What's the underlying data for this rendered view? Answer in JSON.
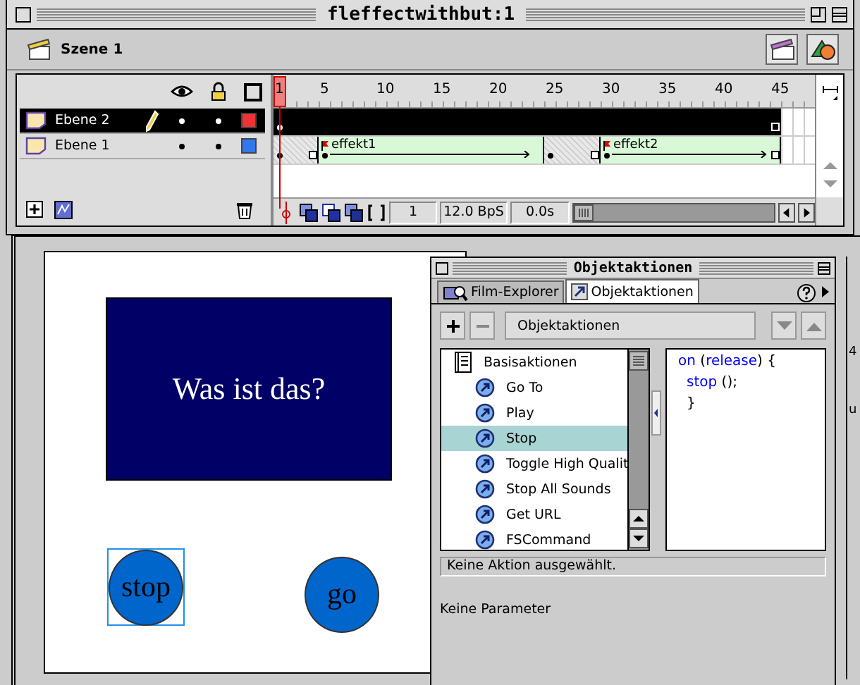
{
  "window": {
    "title": "fleffectwithbut:1"
  },
  "scene": {
    "label": "Szene 1"
  },
  "timeline": {
    "ruler": [
      "1",
      "5",
      "10",
      "15",
      "20",
      "25",
      "30",
      "35",
      "40",
      "45"
    ],
    "layers": [
      {
        "name": "Ebene 2",
        "selected": true,
        "color": "#ee3333",
        "spans": [
          {
            "kind": "static",
            "frames": [
              {
                "kind": "key"
              },
              {
                "kind": "held"
              },
              {
                "kind": "held"
              },
              {
                "kind": "held"
              },
              {
                "kind": "held"
              },
              {
                "kind": "held"
              },
              {
                "kind": "held"
              },
              {
                "kind": "held"
              },
              {
                "kind": "held"
              },
              {
                "kind": "held"
              },
              {
                "kind": "held"
              },
              {
                "kind": "held"
              },
              {
                "kind": "held"
              },
              {
                "kind": "held"
              },
              {
                "kind": "held"
              },
              {
                "kind": "held"
              },
              {
                "kind": "held"
              },
              {
                "kind": "held"
              },
              {
                "kind": "held"
              },
              {
                "kind": "held"
              },
              {
                "kind": "held"
              },
              {
                "kind": "held"
              },
              {
                "kind": "held"
              },
              {
                "kind": "held"
              },
              {
                "kind": "held"
              },
              {
                "kind": "held"
              },
              {
                "kind": "held"
              },
              {
                "kind": "held"
              },
              {
                "kind": "held"
              },
              {
                "kind": "held"
              },
              {
                "kind": "held"
              },
              {
                "kind": "held"
              },
              {
                "kind": "held"
              },
              {
                "kind": "held"
              },
              {
                "kind": "held"
              },
              {
                "kind": "held"
              },
              {
                "kind": "held"
              },
              {
                "kind": "held"
              },
              {
                "kind": "held"
              },
              {
                "kind": "held"
              },
              {
                "kind": "held"
              },
              {
                "kind": "held"
              },
              {
                "kind": "held"
              },
              {
                "kind": "held"
              },
              {
                "kind": "end"
              }
            ]
          }
        ]
      },
      {
        "name": "Ebene 1",
        "selected": false,
        "color": "#3377ee",
        "spans": [
          {
            "kind": "static",
            "frames": [
              {
                "kind": "key"
              },
              {
                "kind": "held"
              },
              {
                "kind": "held"
              },
              {
                "kind": "end"
              }
            ]
          },
          {
            "kind": "tween",
            "label": "effekt1",
            "frames": [
              {
                "kind": "key"
              },
              {
                "kind": "held"
              },
              {
                "kind": "held"
              },
              {
                "kind": "held"
              },
              {
                "kind": "held"
              },
              {
                "kind": "held"
              },
              {
                "kind": "held"
              },
              {
                "kind": "held"
              },
              {
                "kind": "held"
              },
              {
                "kind": "held"
              },
              {
                "kind": "held"
              },
              {
                "kind": "held"
              },
              {
                "kind": "held"
              },
              {
                "kind": "held"
              },
              {
                "kind": "held"
              },
              {
                "kind": "held"
              },
              {
                "kind": "held"
              },
              {
                "kind": "held"
              },
              {
                "kind": "held"
              },
              {
                "kind": "held"
              }
            ]
          },
          {
            "kind": "static",
            "frames": [
              {
                "kind": "key"
              },
              {
                "kind": "held"
              },
              {
                "kind": "held"
              },
              {
                "kind": "held"
              },
              {
                "kind": "end"
              }
            ]
          },
          {
            "kind": "tween",
            "label": "effekt2",
            "frames": [
              {
                "kind": "key"
              },
              {
                "kind": "held"
              },
              {
                "kind": "held"
              },
              {
                "kind": "held"
              },
              {
                "kind": "held"
              },
              {
                "kind": "held"
              },
              {
                "kind": "held"
              },
              {
                "kind": "held"
              },
              {
                "kind": "held"
              },
              {
                "kind": "held"
              },
              {
                "kind": "held"
              },
              {
                "kind": "held"
              },
              {
                "kind": "held"
              },
              {
                "kind": "held"
              },
              {
                "kind": "held"
              },
              {
                "kind": "end"
              }
            ]
          }
        ]
      }
    ],
    "current_frame": "1",
    "frame_rate": "12.0 BpS",
    "elapsed": "0.0s"
  },
  "stage": {
    "headline": "Was ist das?",
    "buttons": [
      {
        "label": "stop",
        "selected": true
      },
      {
        "label": "go",
        "selected": false
      }
    ]
  },
  "panel": {
    "title": "Objektaktionen",
    "tabs": [
      {
        "label": "Film-Explorer",
        "selected": false
      },
      {
        "label": "Objektaktionen",
        "selected": true
      }
    ],
    "dropdown": "Objektaktionen",
    "category": "Basisaktionen",
    "actions": [
      {
        "label": "Go To",
        "selected": false
      },
      {
        "label": "Play",
        "selected": false
      },
      {
        "label": "Stop",
        "selected": true
      },
      {
        "label": "Toggle High Qualit",
        "selected": false
      },
      {
        "label": "Stop All Sounds",
        "selected": false
      },
      {
        "label": "Get URL",
        "selected": false
      },
      {
        "label": "FSCommand",
        "selected": false
      }
    ],
    "code": [
      {
        "indent": false,
        "tokens": [
          {
            "kind": "keyword",
            "text": "on"
          },
          {
            "kind": "plain",
            "text": " ("
          },
          {
            "kind": "keyword",
            "text": "release"
          },
          {
            "kind": "plain",
            "text": ") {"
          }
        ]
      },
      {
        "indent": true,
        "tokens": [
          {
            "kind": "keyword",
            "text": "stop"
          },
          {
            "kind": "plain",
            "text": " ();"
          }
        ]
      },
      {
        "indent": true,
        "tokens": [
          {
            "kind": "plain",
            "text": "}"
          }
        ]
      }
    ],
    "status": "Keine Aktion ausgewählt.",
    "parameters": "Keine Parameter"
  },
  "background_window": {
    "fragments": [
      "4",
      "u"
    ]
  }
}
